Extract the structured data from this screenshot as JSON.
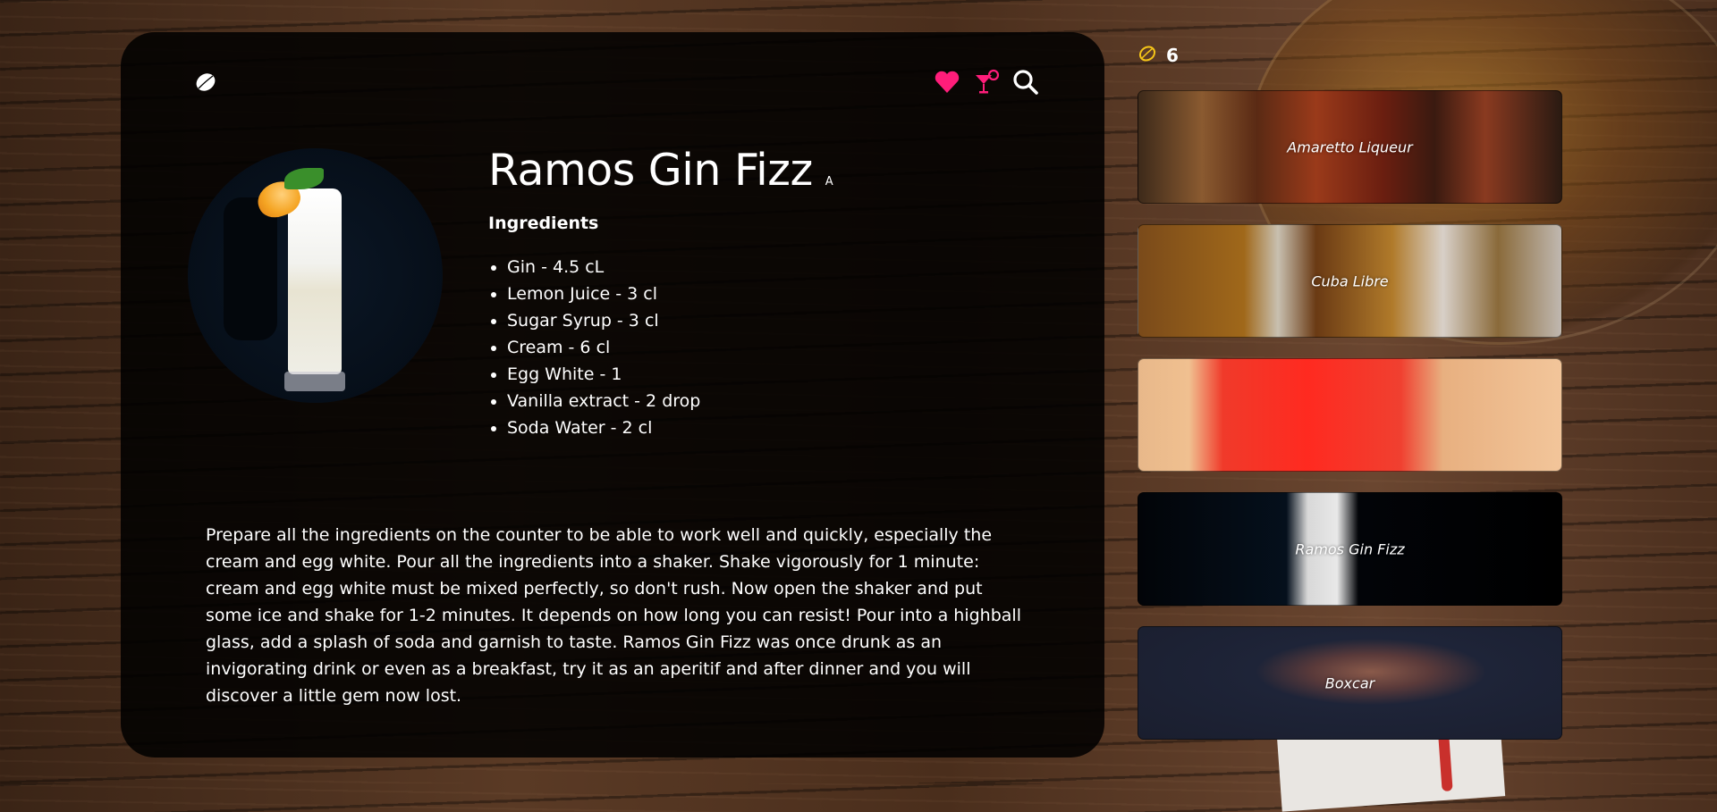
{
  "drink": {
    "name": "Ramos Gin Fizz",
    "alcoholic_tag": "A",
    "ingredients_heading": "Ingredients",
    "ingredients": [
      "Gin - 4.5 cL",
      "Lemon Juice - 3 cl",
      "Sugar Syrup - 3 cl",
      "Cream - 6 cl",
      "Egg White - 1",
      "Vanilla extract - 2 drop",
      "Soda Water - 2 cl"
    ],
    "instructions": "Prepare all the ingredients on the counter to be able to work well and quickly, especially the cream and egg white. Pour all the ingredients into a shaker. Shake vigorously for 1 minute: cream and egg white must be mixed perfectly, so don't rush. Now open the shaker and put some ice and shake for 1-2 minutes. It depends on how long you can resist! Pour into a highball glass, add a splash of soda and garnish to taste. Ramos Gin Fizz was once drunk as an invigorating drink or even as a breakfast, try it as an aperitif and after dinner and you will discover a little gem now lost."
  },
  "header": {
    "icons": [
      "lemon-logo-icon",
      "heart-icon",
      "cocktail-glass-icon",
      "search-icon"
    ]
  },
  "colors": {
    "accent": "#ff1d7a",
    "lemon": "#f5c518",
    "panel": "#000000"
  },
  "sidebar": {
    "count": "6",
    "cards": [
      {
        "name": "Amaretto Liqueur"
      },
      {
        "name": "Cuba Libre"
      },
      {
        "name": ""
      },
      {
        "name": "Ramos Gin Fizz"
      },
      {
        "name": "Boxcar"
      }
    ]
  }
}
